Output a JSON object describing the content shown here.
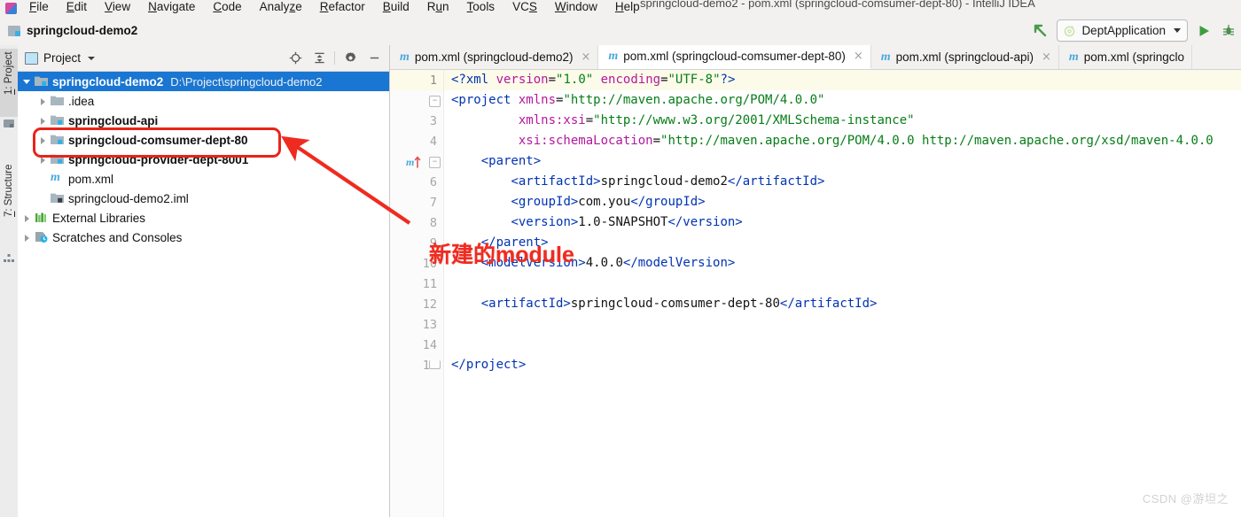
{
  "window": {
    "title": "springcloud-demo2 - pom.xml (springcloud-comsumer-dept-80) - IntelliJ IDEA",
    "app_icon": "intellij-idea-icon"
  },
  "menubar": {
    "items": [
      {
        "label": "File",
        "mnemonic": "F"
      },
      {
        "label": "Edit",
        "mnemonic": "E"
      },
      {
        "label": "View",
        "mnemonic": "V"
      },
      {
        "label": "Navigate",
        "mnemonic": "N"
      },
      {
        "label": "Code",
        "mnemonic": "C"
      },
      {
        "label": "Analyze",
        "mnemonic": "z"
      },
      {
        "label": "Refactor",
        "mnemonic": "R"
      },
      {
        "label": "Build",
        "mnemonic": "B"
      },
      {
        "label": "Run",
        "mnemonic": "u"
      },
      {
        "label": "Tools",
        "mnemonic": "T"
      },
      {
        "label": "VCS",
        "mnemonic": "S"
      },
      {
        "label": "Window",
        "mnemonic": "W"
      },
      {
        "label": "Help",
        "mnemonic": "H"
      }
    ]
  },
  "navbar": {
    "breadcrumb": "springcloud-demo2",
    "breadcrumb_icon": "module-folder-icon",
    "back_icon": "navigate-back-icon",
    "run_config": {
      "label": "DeptApplication",
      "icon": "spring-boot-icon",
      "dropdown_icon": "chevron-down-icon"
    },
    "run_icon": "run-play-icon",
    "debug_icon": "debug-icon"
  },
  "tool_tabs": [
    {
      "label": "1: Project",
      "mnemonic": "1",
      "icon": "project-icon",
      "active": true
    },
    {
      "label": "7: Structure",
      "mnemonic": "7",
      "icon": "structure-icon",
      "active": false
    }
  ],
  "project_pane": {
    "title": "Project",
    "title_icon": "project-view-icon",
    "dropdown_icon": "chevron-down-icon",
    "tools": [
      {
        "name": "locate-icon",
        "glyph": "target"
      },
      {
        "name": "collapse-all-icon",
        "glyph": "collapse"
      },
      {
        "name": "settings-gear-icon",
        "glyph": "gear"
      },
      {
        "name": "hide-icon",
        "glyph": "minus"
      }
    ],
    "tree": [
      {
        "label": "springcloud-demo2",
        "path": "D:\\Project\\springcloud-demo2",
        "icon": "module-folder-icon",
        "indent": 0,
        "arrow": "down",
        "bold": true,
        "selected": true
      },
      {
        "label": ".idea",
        "icon": "folder-icon",
        "indent": 1,
        "arrow": "right",
        "bold": false,
        "selected": false
      },
      {
        "label": "springcloud-api",
        "icon": "module-folder-icon",
        "indent": 1,
        "arrow": "right",
        "bold": true,
        "selected": false
      },
      {
        "label": "springcloud-comsumer-dept-80",
        "icon": "module-folder-icon",
        "indent": 1,
        "arrow": "right",
        "bold": true,
        "selected": false,
        "highlighted": true
      },
      {
        "label": "springcloud-provider-dept-8001",
        "icon": "module-folder-icon",
        "indent": 1,
        "arrow": "right",
        "bold": true,
        "selected": false
      },
      {
        "label": "pom.xml",
        "icon": "maven-m-icon",
        "indent": 1,
        "arrow": "none",
        "bold": false,
        "selected": false
      },
      {
        "label": "springcloud-demo2.iml",
        "icon": "iml-file-icon",
        "indent": 1,
        "arrow": "none",
        "bold": false,
        "selected": false
      },
      {
        "label": "External Libraries",
        "icon": "libraries-icon",
        "indent": 0,
        "arrow": "right",
        "bold": false,
        "selected": false
      },
      {
        "label": "Scratches and Consoles",
        "icon": "scratches-icon",
        "indent": 0,
        "arrow": "right",
        "bold": false,
        "selected": false
      }
    ]
  },
  "editor": {
    "tabs": [
      {
        "label": "pom.xml (springcloud-demo2)",
        "icon": "maven-m-icon",
        "active": false,
        "closable": true
      },
      {
        "label": "pom.xml (springcloud-comsumer-dept-80)",
        "icon": "maven-m-icon",
        "active": true,
        "closable": true
      },
      {
        "label": "pom.xml (springcloud-api)",
        "icon": "maven-m-icon",
        "active": false,
        "closable": true
      },
      {
        "label": "pom.xml (springclo",
        "icon": "maven-m-icon",
        "active": false,
        "closable": false
      }
    ],
    "gutter_icon_line5": "maven-reload-icon",
    "lines": [
      {
        "n": 1,
        "current": true,
        "fold": "",
        "segments": [
          {
            "t": "<?xml ",
            "c": "tag"
          },
          {
            "t": "version",
            "c": "attr"
          },
          {
            "t": "=",
            "c": "txt"
          },
          {
            "t": "\"1.0\"",
            "c": "str"
          },
          {
            "t": " ",
            "c": "txt"
          },
          {
            "t": "encoding",
            "c": "attr"
          },
          {
            "t": "=",
            "c": "txt"
          },
          {
            "t": "\"UTF-8\"",
            "c": "str"
          },
          {
            "t": "?>",
            "c": "tag"
          }
        ]
      },
      {
        "n": 2,
        "current": false,
        "fold": "minus",
        "segments": [
          {
            "t": "<project ",
            "c": "tag"
          },
          {
            "t": "xmlns",
            "c": "attr"
          },
          {
            "t": "=",
            "c": "txt"
          },
          {
            "t": "\"http://maven.apache.org/POM/4.0.0\"",
            "c": "str"
          }
        ]
      },
      {
        "n": 3,
        "current": false,
        "fold": "",
        "segments": [
          {
            "t": "         ",
            "c": "txt"
          },
          {
            "t": "xmlns:xsi",
            "c": "attr"
          },
          {
            "t": "=",
            "c": "txt"
          },
          {
            "t": "\"http://www.w3.org/2001/XMLSchema-instance\"",
            "c": "str"
          }
        ]
      },
      {
        "n": 4,
        "current": false,
        "fold": "",
        "segments": [
          {
            "t": "         ",
            "c": "txt"
          },
          {
            "t": "xsi:schemaLocation",
            "c": "attr"
          },
          {
            "t": "=",
            "c": "txt"
          },
          {
            "t": "\"http://maven.apache.org/POM/4.0.0 http://maven.apache.org/xsd/maven-4.0.0",
            "c": "str"
          }
        ]
      },
      {
        "n": 5,
        "current": false,
        "fold": "minus",
        "segments": [
          {
            "t": "    ",
            "c": "txt"
          },
          {
            "t": "<parent>",
            "c": "tag"
          }
        ]
      },
      {
        "n": 6,
        "current": false,
        "fold": "",
        "segments": [
          {
            "t": "        ",
            "c": "txt"
          },
          {
            "t": "<artifactId>",
            "c": "tag"
          },
          {
            "t": "springcloud-demo2",
            "c": "txt"
          },
          {
            "t": "</artifactId>",
            "c": "tag"
          }
        ]
      },
      {
        "n": 7,
        "current": false,
        "fold": "",
        "segments": [
          {
            "t": "        ",
            "c": "txt"
          },
          {
            "t": "<groupId>",
            "c": "tag"
          },
          {
            "t": "com.you",
            "c": "txt"
          },
          {
            "t": "</groupId>",
            "c": "tag"
          }
        ]
      },
      {
        "n": 8,
        "current": false,
        "fold": "",
        "segments": [
          {
            "t": "        ",
            "c": "txt"
          },
          {
            "t": "<version>",
            "c": "tag"
          },
          {
            "t": "1.0-SNAPSHOT",
            "c": "txt"
          },
          {
            "t": "</version>",
            "c": "tag"
          }
        ]
      },
      {
        "n": 9,
        "current": false,
        "fold": "",
        "segments": [
          {
            "t": "    ",
            "c": "txt"
          },
          {
            "t": "</parent>",
            "c": "tag"
          }
        ]
      },
      {
        "n": 10,
        "current": false,
        "fold": "",
        "segments": [
          {
            "t": "    ",
            "c": "txt"
          },
          {
            "t": "<modelVersion>",
            "c": "tag"
          },
          {
            "t": "4.0.0",
            "c": "txt"
          },
          {
            "t": "</modelVersion>",
            "c": "tag"
          }
        ]
      },
      {
        "n": 11,
        "current": false,
        "fold": "",
        "segments": []
      },
      {
        "n": 12,
        "current": false,
        "fold": "",
        "segments": [
          {
            "t": "    ",
            "c": "txt"
          },
          {
            "t": "<artifactId>",
            "c": "tag"
          },
          {
            "t": "springcloud-comsumer-dept-80",
            "c": "txt"
          },
          {
            "t": "</artifactId>",
            "c": "tag"
          }
        ]
      },
      {
        "n": 13,
        "current": false,
        "fold": "",
        "segments": []
      },
      {
        "n": 14,
        "current": false,
        "fold": "",
        "segments": []
      },
      {
        "n": 15,
        "current": false,
        "fold": "end",
        "segments": [
          {
            "t": "</project>",
            "c": "tag"
          }
        ]
      }
    ]
  },
  "annotations": {
    "box_target": "springcloud-comsumer-dept-80",
    "arrow_label": "新建的module",
    "color": "#e8241a"
  },
  "watermark": "CSDN @游坦之",
  "colors": {
    "selection_blue": "#1976d2",
    "annotation_red": "#e8241a",
    "xml_tag": "#0033b3",
    "xml_attr": "#b5179e",
    "xml_string": "#067d17",
    "run_green": "#3c9e3c"
  }
}
